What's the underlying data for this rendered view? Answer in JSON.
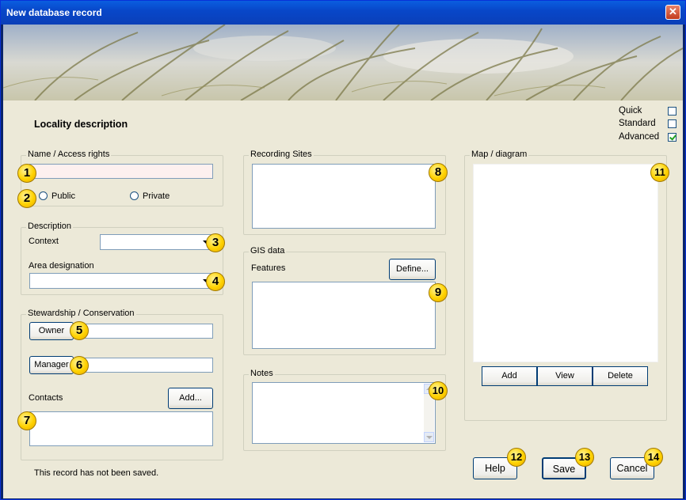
{
  "window": {
    "title": "New database record",
    "close_glyph": "✕"
  },
  "heading": "Locality description",
  "modes": [
    {
      "label": "Quick",
      "checked": false
    },
    {
      "label": "Standard",
      "checked": false
    },
    {
      "label": "Advanced",
      "checked": true
    }
  ],
  "name_group": {
    "legend": "Name / Access rights",
    "name_value": "",
    "public_label": "Public",
    "private_label": "Private"
  },
  "description": {
    "legend": "Description",
    "context_label": "Context",
    "context_value": "",
    "area_label": "Area designation",
    "area_value": ""
  },
  "stewardship": {
    "legend": "Stewardship / Conservation",
    "owner_button": "Owner",
    "owner_value": "",
    "manager_button": "Manager",
    "manager_value": "",
    "contacts_label": "Contacts",
    "add_button": "Add..."
  },
  "recording_sites": {
    "legend": "Recording Sites"
  },
  "gis": {
    "legend": "GIS data",
    "features_label": "Features",
    "define_button": "Define..."
  },
  "notes": {
    "legend": "Notes",
    "value": ""
  },
  "map": {
    "legend": "Map / diagram",
    "add_button": "Add",
    "view_button": "View",
    "delete_button": "Delete"
  },
  "footer": {
    "status": "This record has not been saved.",
    "help_button": "Help",
    "save_button": "Save",
    "cancel_button": "Cancel"
  },
  "callouts": [
    "1",
    "2",
    "3",
    "4",
    "5",
    "6",
    "7",
    "8",
    "9",
    "10",
    "11",
    "12",
    "13",
    "14"
  ],
  "colors": {
    "titlebar": "#0a50d5",
    "dialog_bg": "#ece9d8",
    "badge": "#ffd200",
    "close": "#c33c1d"
  }
}
